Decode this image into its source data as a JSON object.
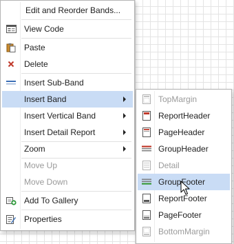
{
  "context_menu": {
    "items": [
      {
        "label": "Edit and Reorder Bands...",
        "icon": "none"
      },
      {
        "label": "View Code",
        "icon": "code-window-icon"
      },
      {
        "label": "Paste",
        "icon": "paste-icon"
      },
      {
        "label": "Delete",
        "icon": "delete-x-icon"
      },
      {
        "label": "Insert Sub-Band",
        "icon": "sub-band-icon"
      },
      {
        "label": "Insert Band",
        "icon": "none",
        "submenu": true,
        "selected": true
      },
      {
        "label": "Insert Vertical Band",
        "icon": "none",
        "submenu": true
      },
      {
        "label": "Insert Detail Report",
        "icon": "none",
        "submenu": true
      },
      {
        "label": "Zoom",
        "icon": "none",
        "submenu": true
      },
      {
        "label": "Move Up",
        "icon": "none",
        "disabled": true
      },
      {
        "label": "Move Down",
        "icon": "none",
        "disabled": true
      },
      {
        "label": "Add To Gallery",
        "icon": "add-to-gallery-icon"
      },
      {
        "label": "Properties",
        "icon": "properties-icon"
      }
    ]
  },
  "insert_band_submenu": {
    "items": [
      {
        "label": "TopMargin",
        "icon": "top-margin-icon",
        "disabled": true
      },
      {
        "label": "ReportHeader",
        "icon": "report-header-icon"
      },
      {
        "label": "PageHeader",
        "icon": "page-header-icon"
      },
      {
        "label": "GroupHeader",
        "icon": "group-header-icon"
      },
      {
        "label": "Detail",
        "icon": "detail-icon",
        "disabled": true
      },
      {
        "label": "GroupFooter",
        "icon": "group-footer-icon",
        "selected": true
      },
      {
        "label": "ReportFooter",
        "icon": "report-footer-icon"
      },
      {
        "label": "PageFooter",
        "icon": "page-footer-icon"
      },
      {
        "label": "BottomMargin",
        "icon": "bottom-margin-icon",
        "disabled": true
      }
    ]
  },
  "colors": {
    "selection": "#c9dcf5",
    "disabled_text": "#9a9a9a",
    "band_red": "#c0392b",
    "band_green": "#3a9a3a"
  }
}
